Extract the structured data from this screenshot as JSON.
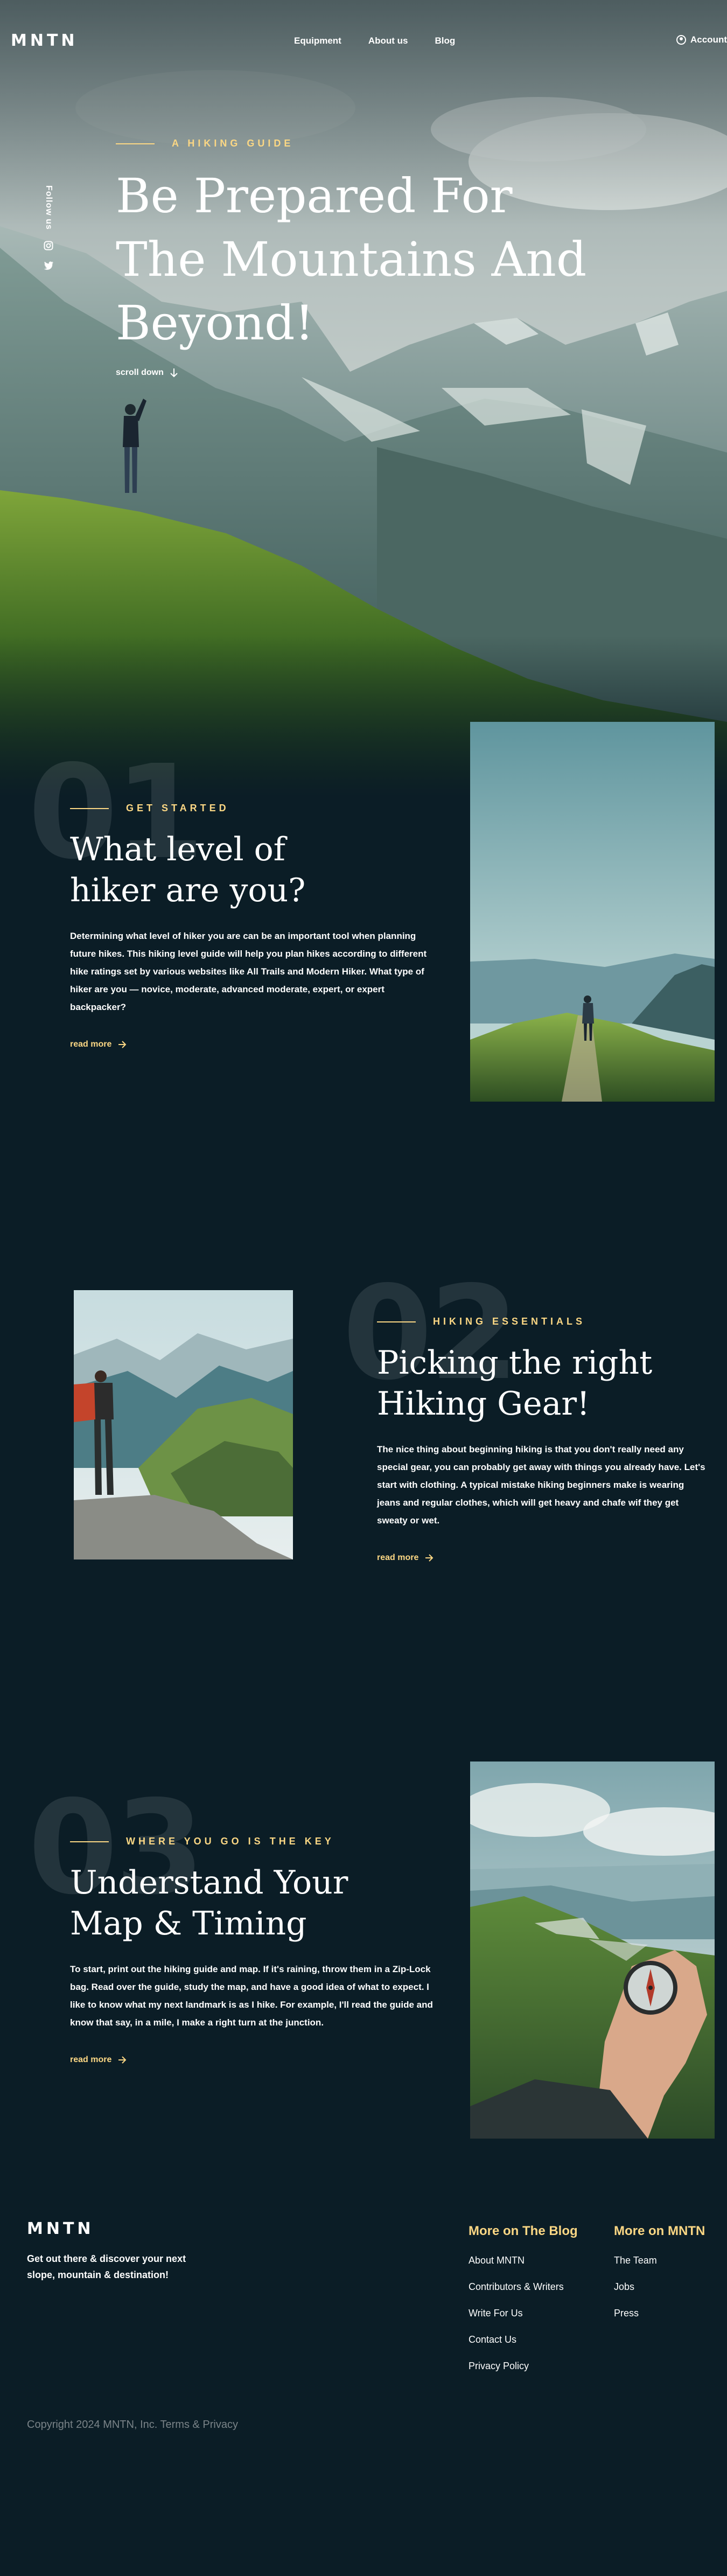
{
  "header": {
    "logo": "MNTN",
    "nav": [
      "Equipment",
      "About us",
      "Blog"
    ],
    "account_label": "Account"
  },
  "hero": {
    "eyebrow": "A Hiking Guide",
    "title": "Be Prepared For The Mountains And Beyond!",
    "scroll_label": "scroll down",
    "follow_label": "Follow us",
    "social_icons": [
      "instagram-icon",
      "twitter-icon"
    ]
  },
  "sections": [
    {
      "number": "01",
      "eyebrow": "Get Started",
      "title": "What level of hiker are you?",
      "body": "Determining what level of hiker you are can be an important tool when planning future hikes. This hiking level guide will help you plan hikes according to different hike ratings set by various websites like All Trails and Modern Hiker. What type of hiker are you — novice, moderate, advanced moderate, expert, or expert backpacker?",
      "cta": "read more"
    },
    {
      "number": "02",
      "eyebrow": "Hiking Essentials",
      "title": "Picking the right Hiking Gear!",
      "body": "The nice thing about beginning hiking is that you don't really need any special gear, you can probably get away with things you already have. Let's start with clothing. A typical mistake hiking beginners make is wearing jeans and regular clothes, which will get heavy and chafe wif they get sweaty or wet.",
      "cta": "read more"
    },
    {
      "number": "03",
      "eyebrow": "Where you go is the key",
      "title": "Understand Your Map & Timing",
      "body": "To start, print out the hiking guide and map. If it's raining, throw them in a Zip-Lock bag. Read over the guide, study the map, and have a good idea of what to expect. I like to know what my next landmark is as I hike. For example, I'll read the guide and know that say, in a mile, I make a right turn at the junction.",
      "cta": "read more"
    }
  ],
  "footer": {
    "logo": "MNTN",
    "tagline": "Get out there & discover your next slope, mountain & destination!",
    "blog_heading": "More on The Blog",
    "blog_links": [
      "About MNTN",
      "Contributors & Writers",
      "Write For Us",
      "Contact Us",
      "Privacy Policy"
    ],
    "mntn_heading": "More on MNTN",
    "mntn_links": [
      "The Team",
      "Jobs",
      "Press"
    ],
    "copyright": "Copyright 2024 MNTN, Inc. Terms & Privacy"
  },
  "colors": {
    "background": "#0b1d26",
    "accent": "#fbd784"
  }
}
